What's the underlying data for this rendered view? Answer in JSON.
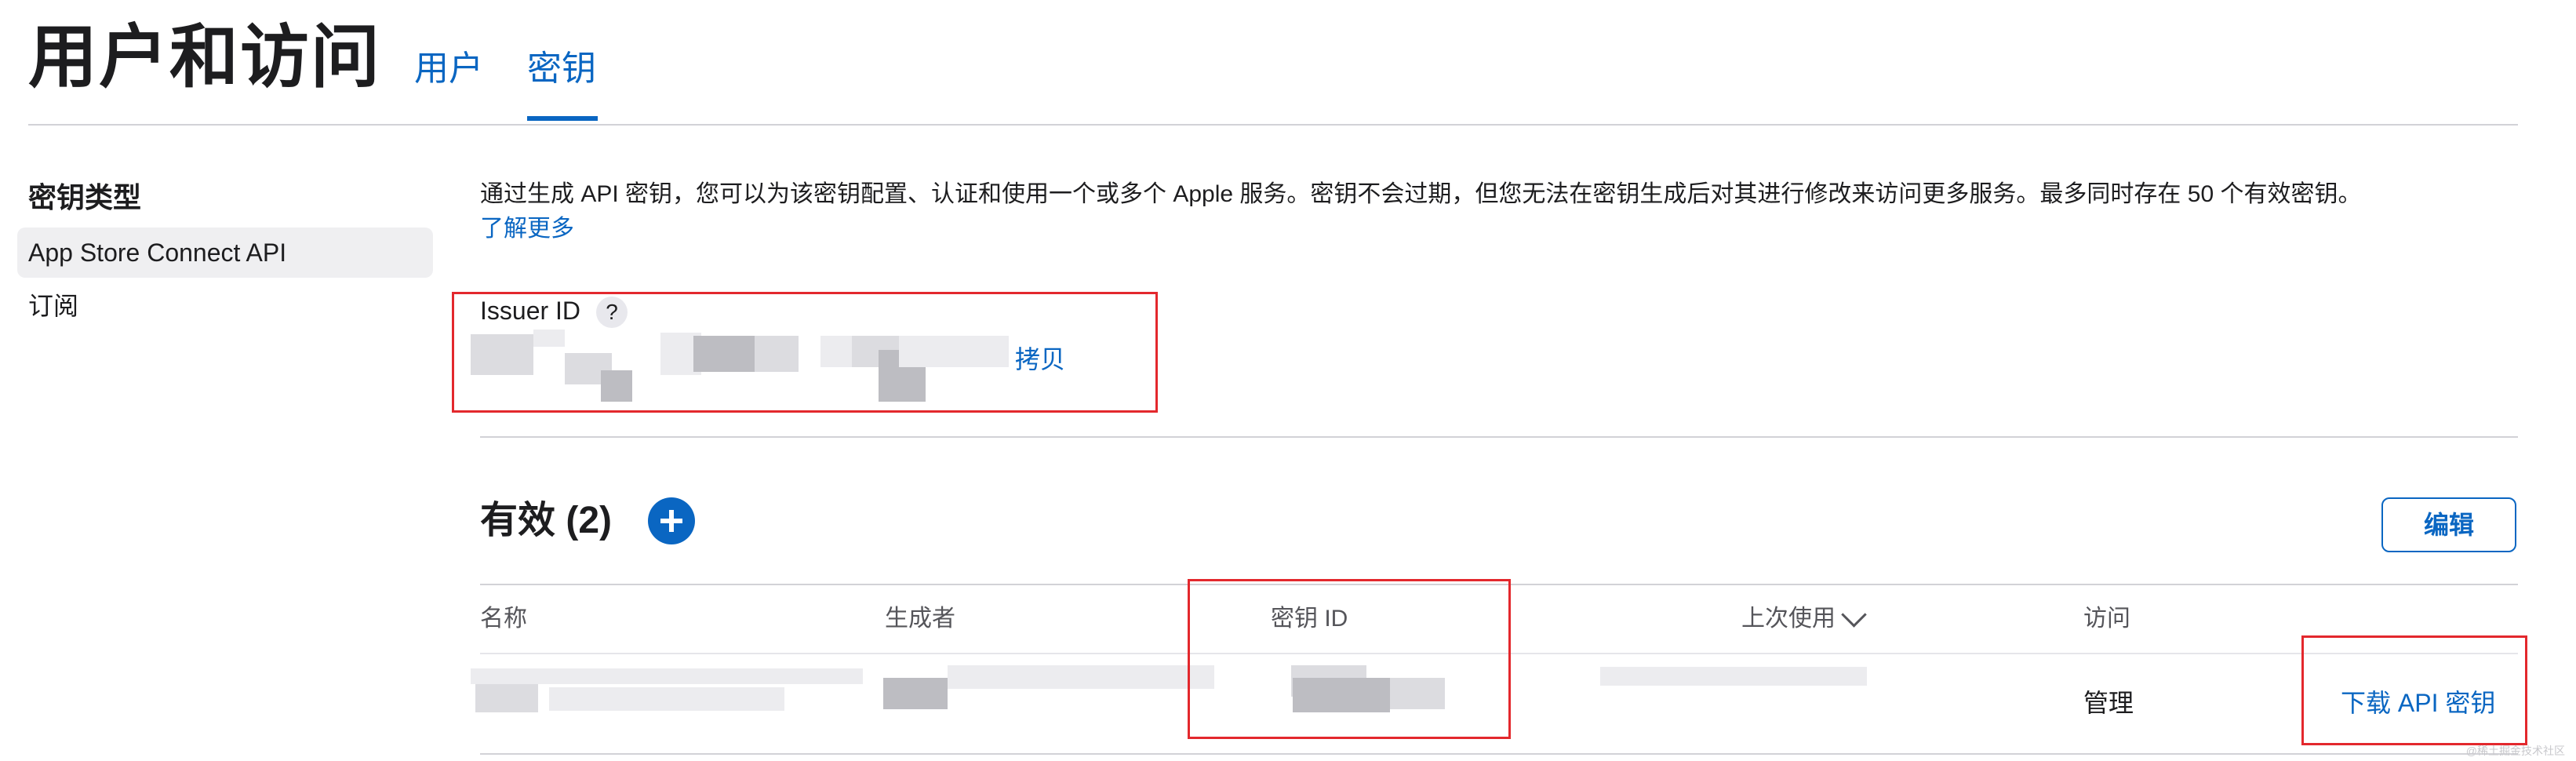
{
  "header": {
    "title": "用户和访问",
    "tabs": [
      {
        "label": "用户",
        "selected": false
      },
      {
        "label": "密钥",
        "selected": true
      }
    ]
  },
  "sidebar": {
    "heading": "密钥类型",
    "items": [
      {
        "label": "App Store Connect API",
        "selected": true
      },
      {
        "label": "订阅",
        "selected": false
      }
    ]
  },
  "intro": {
    "text": "通过生成 API 密钥，您可以为该密钥配置、认证和使用一个或多个 Apple 服务。密钥不会过期，但您无法在密钥生成后对其进行修改来访问更多服务。最多同时存在 50 个有效密钥。",
    "learn_more": "了解更多"
  },
  "issuer": {
    "label": "Issuer ID",
    "help_glyph": "?",
    "value": "",
    "copy_label": "拷贝"
  },
  "active_section": {
    "title": "有效 (2)",
    "edit_label": "编辑"
  },
  "table": {
    "columns": [
      "名称",
      "生成者",
      "密钥 ID",
      "上次使用",
      "访问"
    ],
    "rows": [
      {
        "name": "",
        "created_by": "",
        "key_id": "",
        "last_used": "",
        "access": "管理",
        "action": "下载 API 密钥"
      }
    ]
  },
  "watermark": "@稀土掘金技术社区",
  "colors": {
    "accent": "#0a66c2",
    "annotation_red": "#e3282d",
    "divider": "#d2d2d7",
    "sidebar_selected_bg": "#efeff1"
  },
  "icons": {
    "help": "question-circle-icon",
    "add": "plus-circle-icon",
    "sort": "chevron-down-icon"
  }
}
